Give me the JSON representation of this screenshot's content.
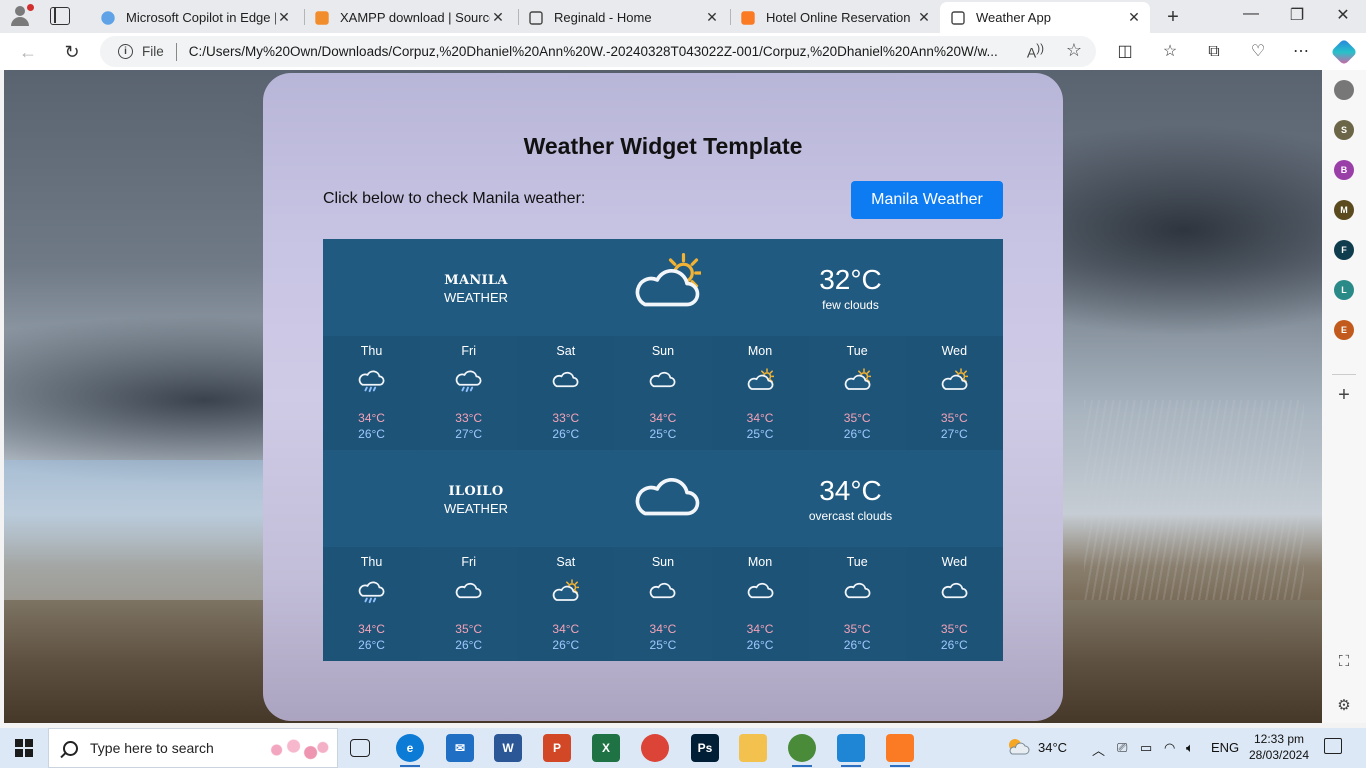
{
  "browser": {
    "tabs": [
      {
        "title": "Microsoft Copilot in Edge | M",
        "fav_color": "#5fa3e6"
      },
      {
        "title": "XAMPP download | SourceF",
        "fav_color": "#f28d2d"
      },
      {
        "title": "Reginald - Home",
        "fav_color": "#444444"
      },
      {
        "title": "Hotel Online Reservation",
        "fav_color": "#fb7a24"
      },
      {
        "title": "Weather App",
        "fav_color": "#444444"
      }
    ],
    "active_tab": 4,
    "address": {
      "scheme_label": "File",
      "url": "C:/Users/My%20Own/Downloads/Corpuz,%20Dhaniel%20Ann%20W.-20240328T043022Z-001/Corpuz,%20Dhaniel%20Ann%20W/w..."
    },
    "sidebar": [
      {
        "letter": "",
        "color": "#777777"
      },
      {
        "letter": "S",
        "color": "#6b6648"
      },
      {
        "letter": "B",
        "color": "#9a3fa8"
      },
      {
        "letter": "M",
        "color": "#5a4a1e"
      },
      {
        "letter": "F",
        "color": "#0f3d4d"
      },
      {
        "letter": "L",
        "color": "#2a8a88"
      },
      {
        "letter": "E",
        "color": "#c25a1e"
      }
    ]
  },
  "page": {
    "title": "Weather Widget Template",
    "prompt": "Click below to check Manila weather:",
    "button_label": "Manila Weather",
    "colors": {
      "widget_bg": "#215a80",
      "button": "#0d7cf2",
      "high_temp": "#f4a3b7",
      "low_temp": "#9fc8ff"
    },
    "cities": [
      {
        "name": "MANILA",
        "subtitle": "WEATHER",
        "icon": "sun-cloud-icon",
        "temp": "32°C",
        "desc": "few clouds",
        "forecast": [
          {
            "day": "Thu",
            "icon": "rain-cloud-icon",
            "hi": "34°C",
            "lo": "26°C"
          },
          {
            "day": "Fri",
            "icon": "rain-cloud-icon",
            "hi": "33°C",
            "lo": "27°C"
          },
          {
            "day": "Sat",
            "icon": "cloud-icon",
            "hi": "33°C",
            "lo": "26°C"
          },
          {
            "day": "Sun",
            "icon": "cloud-icon",
            "hi": "34°C",
            "lo": "25°C"
          },
          {
            "day": "Mon",
            "icon": "sun-cloud-icon",
            "hi": "34°C",
            "lo": "25°C"
          },
          {
            "day": "Tue",
            "icon": "sun-cloud-icon",
            "hi": "35°C",
            "lo": "26°C"
          },
          {
            "day": "Wed",
            "icon": "sun-cloud-icon",
            "hi": "35°C",
            "lo": "27°C"
          }
        ]
      },
      {
        "name": "ILOILO",
        "subtitle": "WEATHER",
        "icon": "cloud-icon",
        "temp": "34°C",
        "desc": "overcast clouds",
        "forecast": [
          {
            "day": "Thu",
            "icon": "rain-cloud-icon",
            "hi": "34°C",
            "lo": "26°C"
          },
          {
            "day": "Fri",
            "icon": "cloud-icon",
            "hi": "35°C",
            "lo": "26°C"
          },
          {
            "day": "Sat",
            "icon": "sun-cloud-icon",
            "hi": "34°C",
            "lo": "26°C"
          },
          {
            "day": "Sun",
            "icon": "cloud-icon",
            "hi": "34°C",
            "lo": "25°C"
          },
          {
            "day": "Mon",
            "icon": "cloud-icon",
            "hi": "34°C",
            "lo": "26°C"
          },
          {
            "day": "Tue",
            "icon": "cloud-icon",
            "hi": "35°C",
            "lo": "26°C"
          },
          {
            "day": "Wed",
            "icon": "cloud-icon",
            "hi": "35°C",
            "lo": "26°C"
          }
        ]
      }
    ]
  },
  "taskbar": {
    "search_placeholder": "Type here to search",
    "apps": [
      {
        "name": "task-view-icon",
        "label": "",
        "color": "#dce8f5"
      },
      {
        "name": "edge-icon",
        "label": "e",
        "color": "#0c7bd6"
      },
      {
        "name": "mail-icon",
        "label": "✉",
        "color": "#1f6fc4"
      },
      {
        "name": "word-icon",
        "label": "W",
        "color": "#2b5797"
      },
      {
        "name": "powerpoint-icon",
        "label": "P",
        "color": "#d24726"
      },
      {
        "name": "excel-icon",
        "label": "X",
        "color": "#1f7244"
      },
      {
        "name": "chrome-icon",
        "label": "",
        "color": "#db4437"
      },
      {
        "name": "photoshop-icon",
        "label": "Ps",
        "color": "#001e36"
      },
      {
        "name": "file-explorer-icon",
        "label": "",
        "color": "#f2c14e"
      },
      {
        "name": "chrome-profile-icon",
        "label": "",
        "color": "#4a8b3a"
      },
      {
        "name": "vscode-icon",
        "label": "",
        "color": "#1f86d6"
      },
      {
        "name": "xampp-icon",
        "label": "",
        "color": "#fb7a24"
      }
    ],
    "weather_temp": "34°C",
    "language": "ENG",
    "time": "12:33 pm",
    "date": "28/03/2024"
  }
}
